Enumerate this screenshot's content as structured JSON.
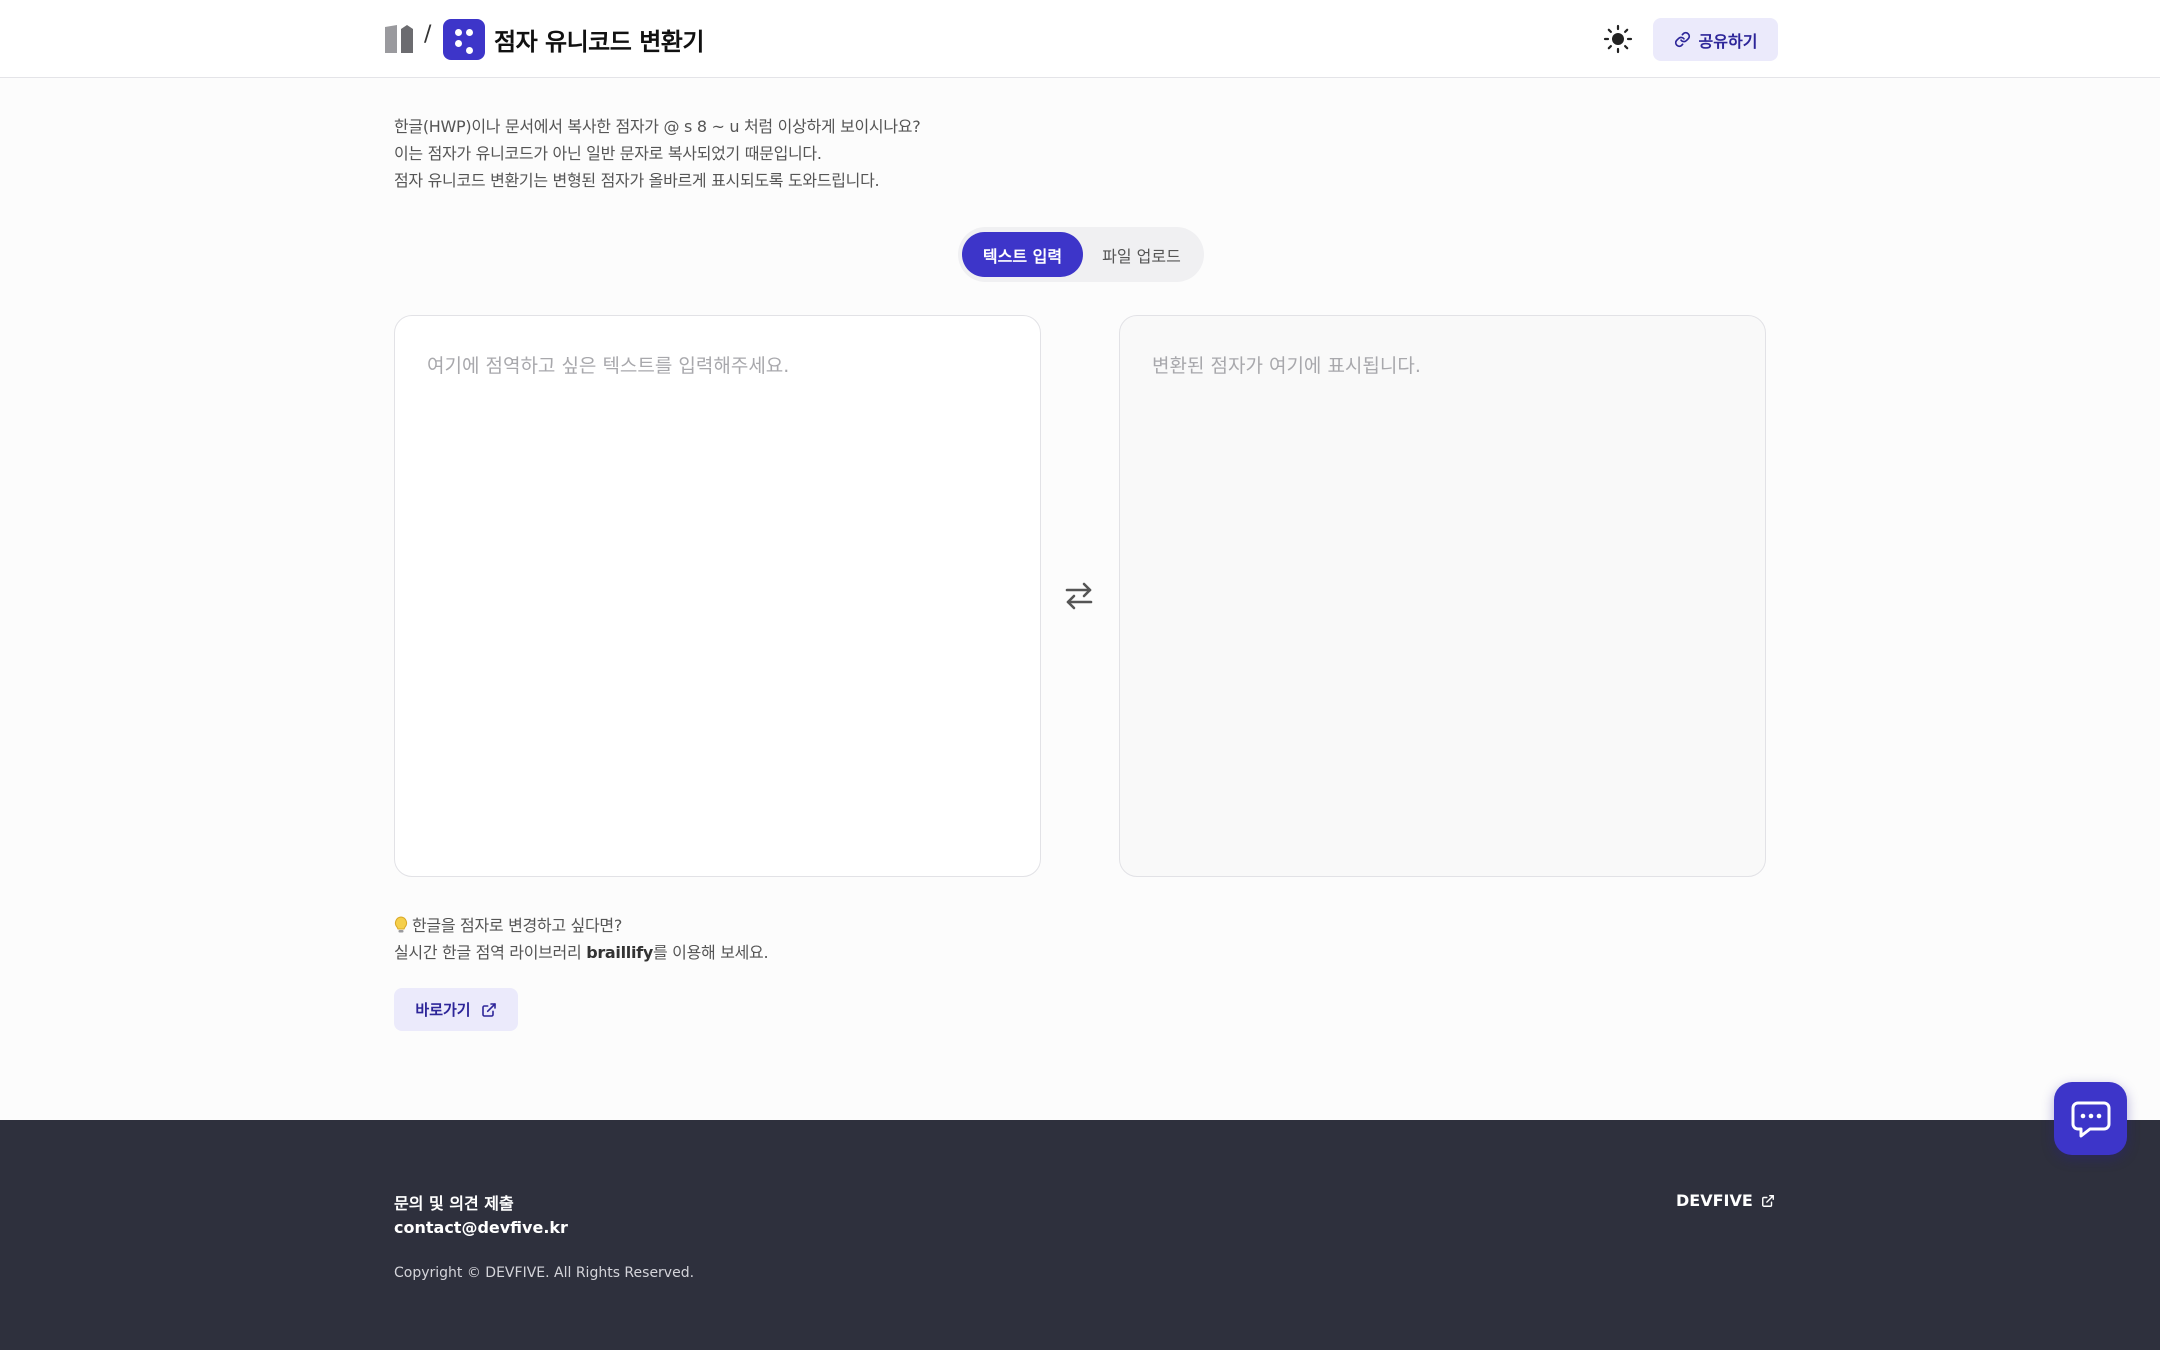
{
  "header": {
    "separator": "/",
    "title": "점자 유니코드 변환기",
    "share_label": "공유하기"
  },
  "intro": {
    "lines": [
      "한글(HWP)이나 문서에서 복사한 점자가 @ s 8 ~ u 처럼 이상하게 보이시나요?",
      "이는 점자가 유니코드가 아닌 일반 문자로 복사되었기 때문입니다.",
      "점자 유니코드 변환기는 변형된 점자가 올바르게 표시되도록 도와드립니다."
    ]
  },
  "mode_toggle": {
    "tabs": [
      {
        "label": "텍스트 입력",
        "active": true
      },
      {
        "label": "파일 업로드",
        "active": false
      }
    ]
  },
  "input_panel": {
    "value": "",
    "placeholder": "여기에 점역하고 싶은 텍스트를 입력해주세요."
  },
  "output_panel": {
    "placeholder": "변환된 점자가 여기에 표시됩니다."
  },
  "tip": {
    "line1": "한글을 점자로 변경하고 싶다면?",
    "line2_prefix": "실시간 한글 점역 라이브러리 ",
    "line2_link": "braillify",
    "line2_suffix": "를 이용해 보세요.",
    "button_label": "바로가기"
  },
  "footer": {
    "contact_title": "문의 및 의견 제출",
    "email": "contact@devfive.kr",
    "copyright": "Copyright © DEVFIVE. All Rights Reserved.",
    "brand": "DEVFIVE"
  },
  "colors": {
    "accent": "#3d35c9",
    "accent_light": "#ebeafb",
    "footer_bg": "#2e303d"
  }
}
